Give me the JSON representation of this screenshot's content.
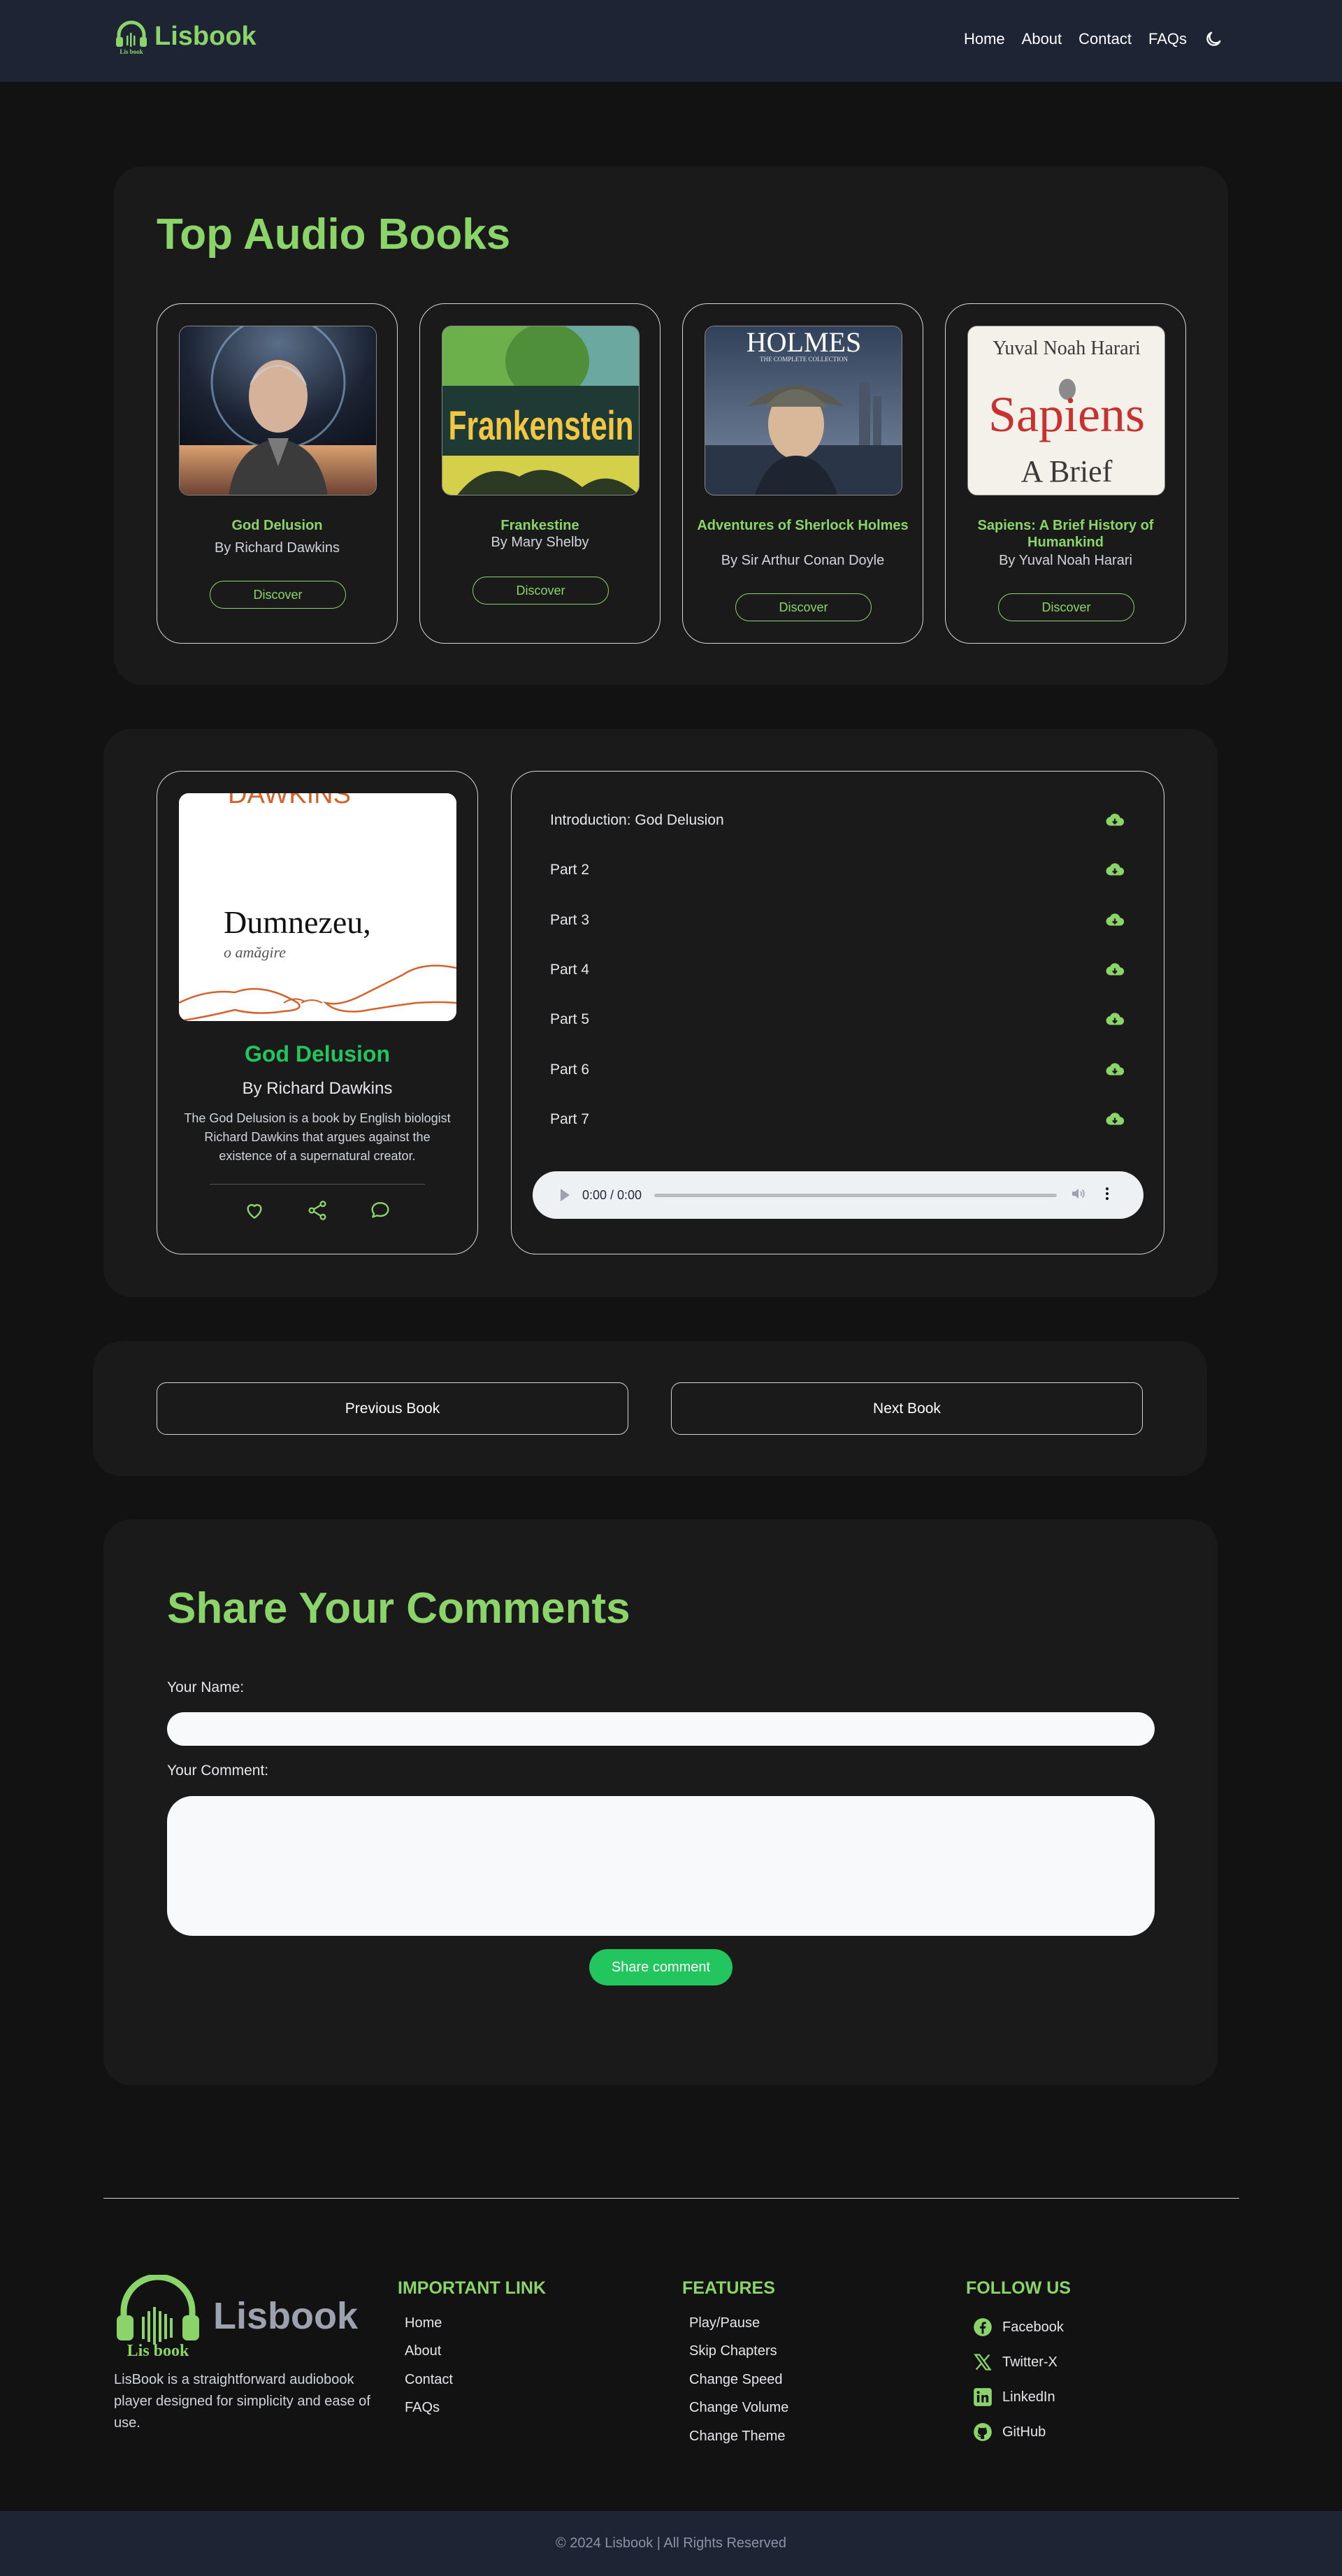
{
  "header": {
    "logo_text": "Lisbook",
    "logo_sub": "Lis book",
    "nav": [
      "Home",
      "About",
      "Contact",
      "FAQs"
    ]
  },
  "top_books": {
    "title": "Top Audio Books",
    "books": [
      {
        "title": "God Delusion",
        "author": "By Richard Dawkins",
        "button": "Discover"
      },
      {
        "title": "Frankestine",
        "author": "By Mary Shelby",
        "button": "Discover"
      },
      {
        "title": "Adventures of Sherlock Holmes",
        "author": "By Sir Arthur Conan Doyle",
        "button": "Discover"
      },
      {
        "title": "Sapiens: A Brief History of Humankind",
        "author": "By Yuval Noah Harari",
        "button": "Discover"
      }
    ],
    "cover_text": {
      "frankenstein": "Frankenstein",
      "holmes": "HOLMES",
      "holmes_sub": "THE COMPLETE COLLECTION",
      "sapiens_author": "Yuval Noah Harari",
      "sapiens_title": "Sapiens",
      "sapiens_sub": "A Brief"
    }
  },
  "player": {
    "cover_author": "DAWKINS",
    "cover_title": "Dumnezeu,",
    "cover_subtitle": "o amăgire",
    "title": "God Delusion",
    "author": "By Richard Dawkins",
    "description": "The God Delusion is a book by English biologist Richard Dawkins that argues against the existence of a supernatural creator.",
    "tracks": [
      "Introduction: God Delusion",
      "Part 2",
      "Part 3",
      "Part 4",
      "Part 5",
      "Part 6",
      "Part 7"
    ],
    "time": "0:00 / 0:00"
  },
  "book_nav": {
    "previous": "Previous Book",
    "next": "Next Book"
  },
  "comments": {
    "title": "Share Your Comments",
    "name_label": "Your Name:",
    "comment_label": "Your Comment:",
    "button": "Share comment"
  },
  "footer": {
    "logo_text": "Lisbook",
    "logo_sub": "Lis book",
    "about": "LisBook is a straightforward audiobook player designed for simplicity and ease of use.",
    "important_title": "IMPORTANT LINK",
    "important_links": [
      "Home",
      "About",
      "Contact",
      "FAQs"
    ],
    "features_title": "FEATURES",
    "features": [
      "Play/Pause",
      "Skip Chapters",
      "Change Speed",
      "Change Volume",
      "Change Theme"
    ],
    "follow_title": "FOLLOW US",
    "social": [
      "Facebook",
      "Twitter-X",
      "LinkedIn",
      "GitHub"
    ],
    "copyright": "© 2024 Lisbook | All Rights Reserved"
  },
  "colors": {
    "accent": "#8bd46a",
    "primary_green": "#22c55e",
    "background": "#121212",
    "panel": "#1a1a1a",
    "header": "#1e2433"
  }
}
